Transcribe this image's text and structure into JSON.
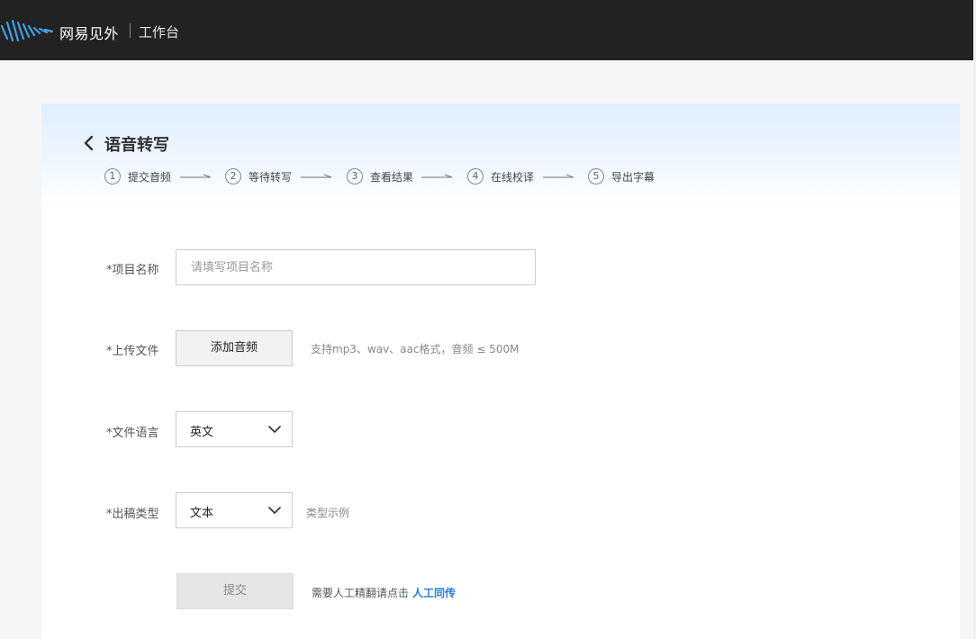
{
  "app": {
    "brand": "网易见外",
    "workspace": "工作台"
  },
  "page": {
    "title": "语音转写",
    "steps": [
      {
        "num": "1",
        "label": "提交音频"
      },
      {
        "num": "2",
        "label": "等待转写"
      },
      {
        "num": "3",
        "label": "查看结果"
      },
      {
        "num": "4",
        "label": "在线校译"
      },
      {
        "num": "5",
        "label": "导出字幕"
      }
    ]
  },
  "form": {
    "project_name": {
      "label": "*项目名称",
      "placeholder": "请填写项目名称",
      "value": ""
    },
    "upload": {
      "label": "*上传文件",
      "button": "添加音频",
      "hint": "支持mp3、wav、aac格式，音频 ≤ 500M"
    },
    "language": {
      "label": "*文件语言",
      "value": "英文"
    },
    "output_type": {
      "label": "*出稿类型",
      "value": "文本",
      "hint": "类型示例"
    },
    "submit": {
      "label": "提交",
      "note": "需要人工精翻请点击",
      "link": "人工同传"
    }
  },
  "colors": {
    "topbar": "#222222",
    "accent": "#2a7ae2",
    "logo_blue": "#3fa0e8"
  }
}
